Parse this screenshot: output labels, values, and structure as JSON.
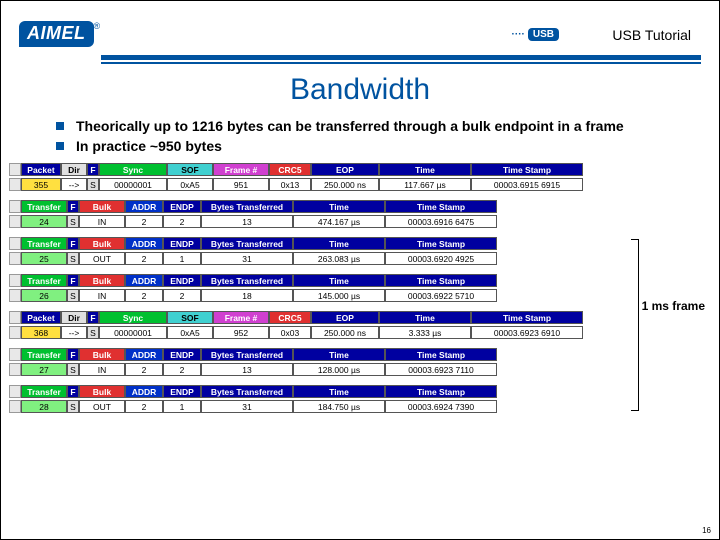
{
  "header": {
    "logo_text": "AIMEL",
    "usb_badge": "USB",
    "doc_title": "USB Tutorial"
  },
  "title": "Bandwidth",
  "bullets": [
    "Theorically up to 1216 bytes can be transferred through a bulk endpoint in a frame",
    "In practice ~950 bytes"
  ],
  "cols_packet": {
    "packet": "Packet",
    "dir": "Dir",
    "f": "F",
    "sync": "Sync",
    "sof": "SOF",
    "frame": "Frame #",
    "crc": "CRC5",
    "eop": "EOP",
    "time": "Time",
    "stamp": "Time Stamp"
  },
  "cols_transfer": {
    "transfer": "Transfer",
    "f": "F",
    "bulk": "Bulk",
    "addr": "ADDR",
    "endp": "ENDP",
    "bytes": "Bytes Transferred",
    "time": "Time",
    "stamp": "Time Stamp"
  },
  "packet1": {
    "id": "355",
    "dir": "-->",
    "f": "S",
    "sync": "00000001",
    "sof": "0xA5",
    "frame": "951",
    "crc": "0x13",
    "eop": "250.000 ns",
    "time": "117.667 µs",
    "stamp": "00003.6915 6915"
  },
  "t1": {
    "id": "24",
    "f": "S",
    "bulk": "IN",
    "addr": "2",
    "endp": "2",
    "bytes": "13",
    "time": "474.167 µs",
    "stamp": "00003.6916 6475"
  },
  "t2": {
    "id": "25",
    "f": "S",
    "bulk": "OUT",
    "addr": "2",
    "endp": "1",
    "bytes": "31",
    "time": "263.083 µs",
    "stamp": "00003.6920 4925"
  },
  "t3": {
    "id": "26",
    "f": "S",
    "bulk": "IN",
    "addr": "2",
    "endp": "2",
    "bytes": "18",
    "time": "145.000 µs",
    "stamp": "00003.6922 5710"
  },
  "packet2": {
    "id": "368",
    "dir": "-->",
    "f": "S",
    "sync": "00000001",
    "sof": "0xA5",
    "frame": "952",
    "crc": "0x03",
    "eop": "250.000 ns",
    "time": "3.333 µs",
    "stamp": "00003.6923 6910"
  },
  "t4": {
    "id": "27",
    "f": "S",
    "bulk": "IN",
    "addr": "2",
    "endp": "2",
    "bytes": "13",
    "time": "128.000 µs",
    "stamp": "00003.6923 7110"
  },
  "t5": {
    "id": "28",
    "f": "S",
    "bulk": "OUT",
    "addr": "2",
    "endp": "1",
    "bytes": "31",
    "time": "184.750 µs",
    "stamp": "00003.6924 7390"
  },
  "frame_label": "1 ms frame",
  "page_no": "16"
}
